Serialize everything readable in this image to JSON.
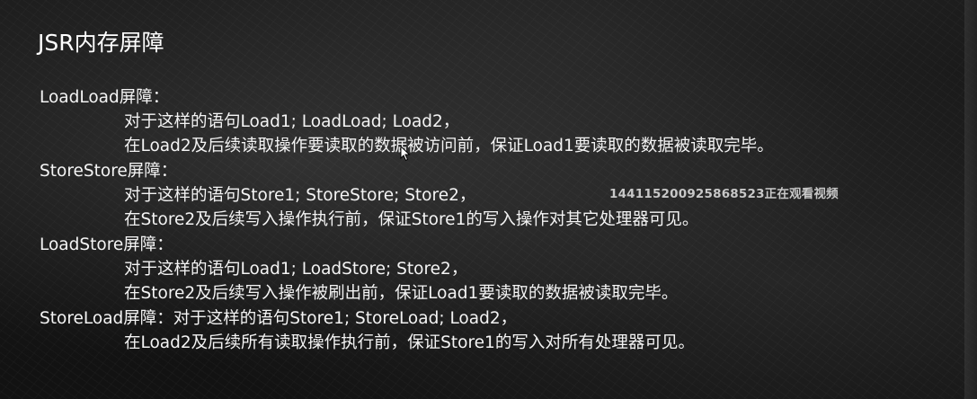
{
  "slide": {
    "title": "JSR内存屏障",
    "watermark": "1441152009258685​23正在观看视频",
    "lines": [
      "LoadLoad屏障：",
      "对于这样的语句Load1; LoadLoad; Load2，",
      "在Load2及后续读取操作要读取的数据被访问前，保证Load1要读取的数据被读取完毕。",
      "StoreStore屏障：",
      "对于这样的语句Store1; StoreStore; Store2，",
      "在Store2及后续写入操作执行前，保证Store1的写入操作对其它处理器可见。",
      "LoadStore屏障：",
      "对于这样的语句Load1; LoadStore; Store2，",
      "在Store2及后续写入操作被刷出前，保证Load1要读取的数据被读取完毕。",
      "StoreLoad屏障：对于这样的语句Store1; StoreLoad; Load2，",
      "在Load2及后续所有读取操作执行前，保证Store1的写入对所有处理器可见。"
    ]
  },
  "colors": {
    "background": "#161616",
    "text": "#f4f4f4",
    "watermark": "#c8c8c8"
  },
  "icons": {
    "cursor": "mouse-pointer-icon"
  }
}
